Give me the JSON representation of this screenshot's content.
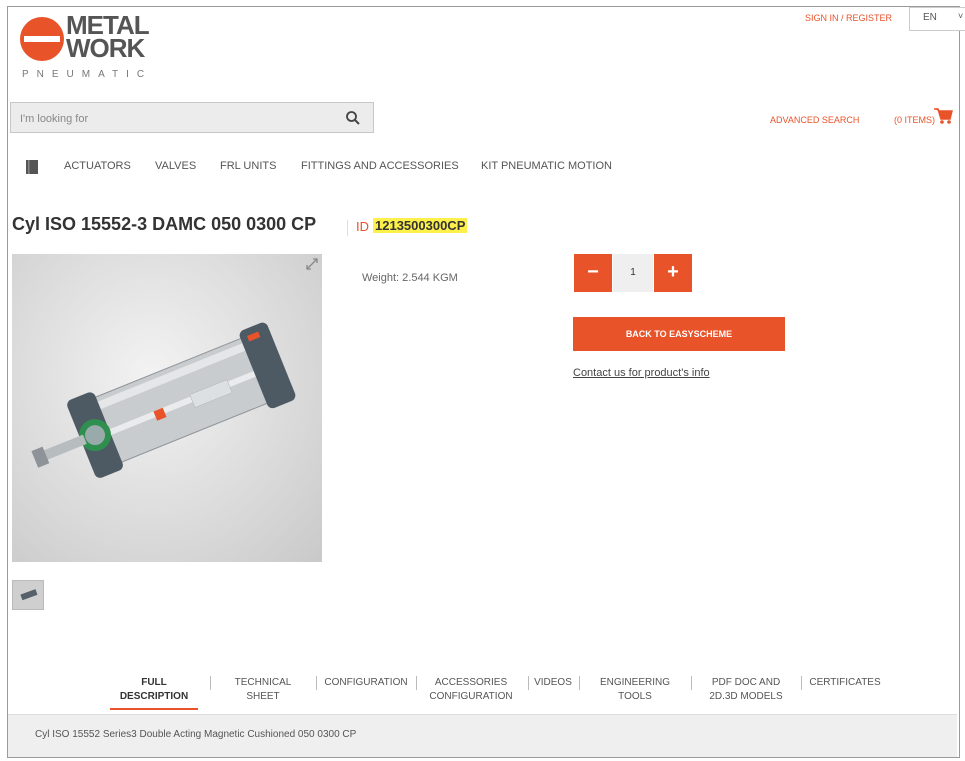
{
  "brand": {
    "logo_text_line1": "METAL",
    "logo_text_line2": "WORK",
    "logo_sub": "PNEUMATIC",
    "accent": "#e8532a"
  },
  "topbar": {
    "sign_in": "SIGN IN / REGISTER",
    "language": "EN"
  },
  "search": {
    "placeholder": "I'm looking for",
    "icon": "search-icon"
  },
  "header_links": {
    "advanced_search": "ADVANCED SEARCH",
    "cart": "(0 ITEMS)",
    "cart_icon": "cart-icon"
  },
  "nav": {
    "catalog_icon": "book-icon",
    "items": [
      "ACTUATORS",
      "VALVES",
      "FRL UNITS",
      "FITTINGS AND ACCESSORIES",
      "KIT PNEUMATIC MOTION"
    ]
  },
  "product": {
    "title": "Cyl ISO 15552-3 DAMC 050 0300 CP",
    "id_label": "ID",
    "id_value": "1213500300CP",
    "weight": "Weight: 2.544 KGM",
    "quantity": "1",
    "minus": "−",
    "plus": "+",
    "back_button": "BACK TO EASYSCHEME",
    "contact_link": "Contact us for product's info"
  },
  "tabs": [
    {
      "line1": "FULL",
      "line2": "DESCRIPTION"
    },
    {
      "line1": "TECHNICAL SHEET",
      "line2": ""
    },
    {
      "line1": "CONFIGURATION",
      "line2": ""
    },
    {
      "line1": "ACCESSORIES",
      "line2": "CONFIGURATION"
    },
    {
      "line1": "VIDEOS",
      "line2": ""
    },
    {
      "line1": "ENGINEERING",
      "line2": "TOOLS"
    },
    {
      "line1": "PDF DOC AND",
      "line2": "2D.3D MODELS"
    },
    {
      "line1": "CERTIFICATES",
      "line2": ""
    }
  ],
  "description": "Cyl ISO 15552 Series3 Double Acting Magnetic Cushioned 050 0300 CP"
}
